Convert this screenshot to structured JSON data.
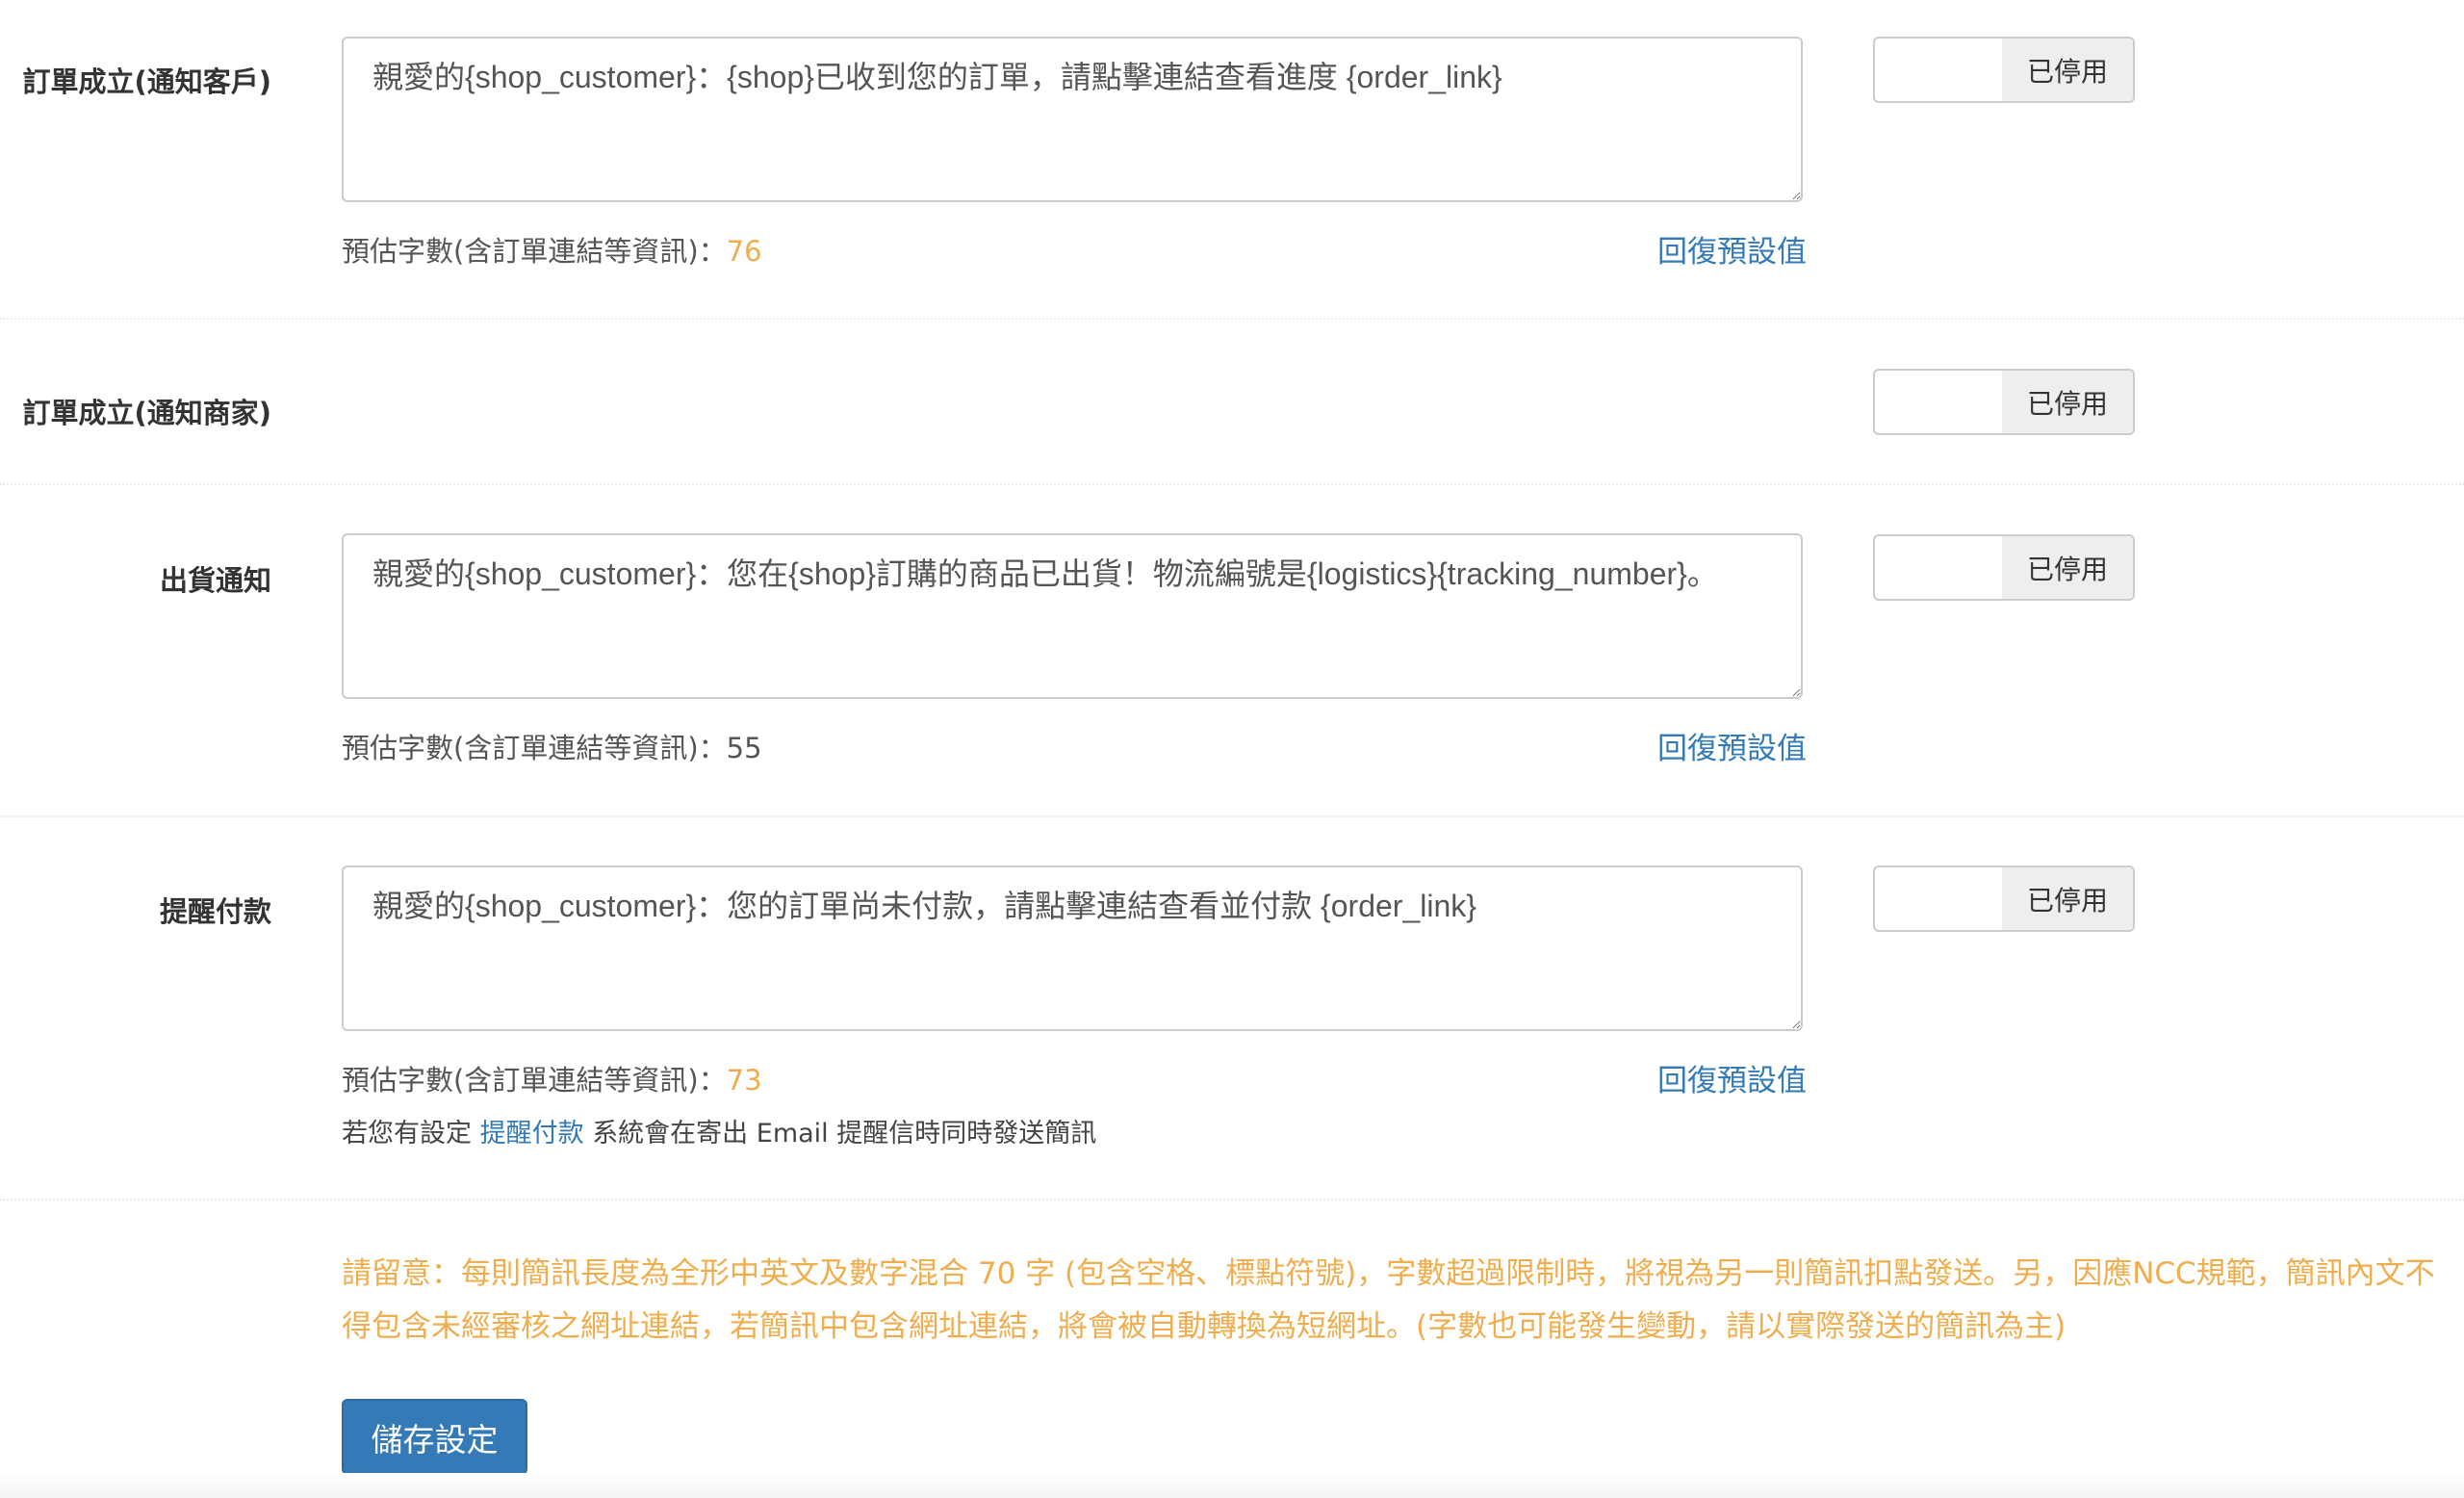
{
  "toggle_label": "已停用",
  "reset_label": "回復預設值",
  "count_label": "預估字數(含訂單連結等資訊)：",
  "sections": [
    {
      "label": "訂單成立(通知客戶)",
      "message": "親愛的{shop_customer}：{shop}已收到您的訂單，請點擊連結查看進度 {order_link}",
      "char_count": "76"
    },
    {
      "label": "訂單成立(通知商家)"
    },
    {
      "label": "出貨通知",
      "message": "親愛的{shop_customer}：您在{shop}訂購的商品已出貨！物流編號是{logistics}{tracking_number}。",
      "char_count": "55"
    },
    {
      "label": "提醒付款",
      "message": "親愛的{shop_customer}：您的訂單尚未付款，請點擊連結查看並付款 {order_link}",
      "char_count": "73",
      "hint_before": "若您有設定",
      "hint_link": "提醒付款",
      "hint_after": "系統會在寄出 Email 提醒信時同時發送簡訊"
    }
  ],
  "notice_text": "請留意：每則簡訊長度為全形中英文及數字混合 70 字 (包含空格、標點符號)，字數超過限制時，將視為另一則簡訊扣點發送。另，因應NCC規範，簡訊內文不得包含未經審核之網址連結，若簡訊中包含網址連結，將會被自動轉換為短網址。(字數也可能發生變動，請以實際發送的簡訊為主)",
  "save_label": "儲存設定",
  "colors": {
    "accent": "#337ab7",
    "warning": "#f0ad4e",
    "toggle_off_bg": "#eeeeee"
  }
}
